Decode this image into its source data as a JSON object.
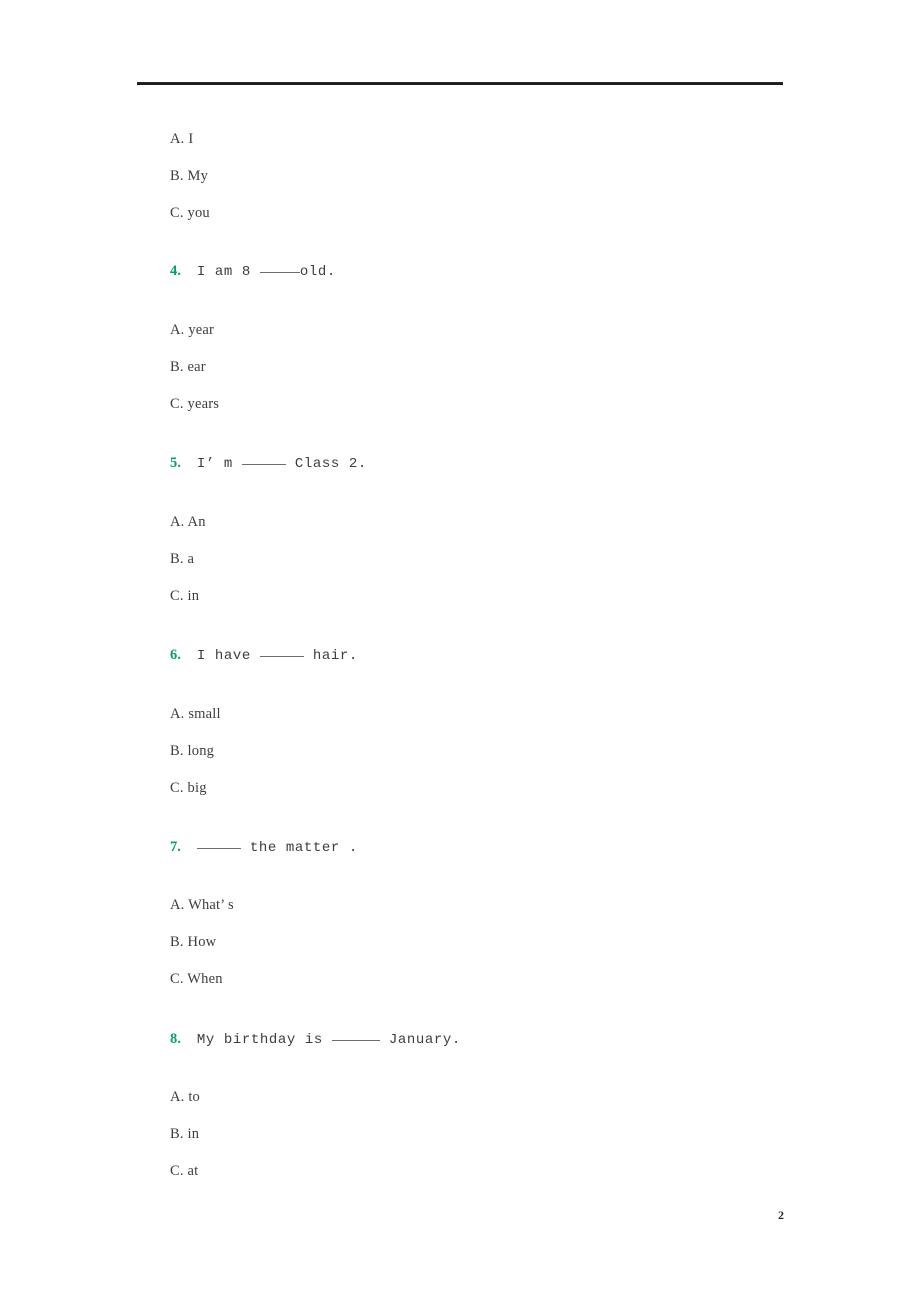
{
  "document": {
    "page_number": "2",
    "accent_color": "#00a070",
    "text_color": "#3d3d3d"
  },
  "orphan_options": [
    {
      "letter": "A.",
      "text": "I"
    },
    {
      "letter": "B.",
      "text": "My"
    },
    {
      "letter": "C.",
      "text": "you"
    }
  ],
  "questions": [
    {
      "number": "4.",
      "stem_before": "I am 8 ",
      "stem_after": "old.",
      "options": [
        {
          "letter": "A.",
          "text": "year"
        },
        {
          "letter": "B.",
          "text": "ear"
        },
        {
          "letter": "C.",
          "text": "years"
        }
      ]
    },
    {
      "number": "5.",
      "stem_before": "I’ m ",
      "stem_after": " Class 2.",
      "options": [
        {
          "letter": "A.",
          "text": "An"
        },
        {
          "letter": "B.",
          "text": "a"
        },
        {
          "letter": "C.",
          "text": "in"
        }
      ]
    },
    {
      "number": "6.",
      "stem_before": "I have ",
      "stem_after": " hair.",
      "options": [
        {
          "letter": "A.",
          "text": "small"
        },
        {
          "letter": "B.",
          "text": "long"
        },
        {
          "letter": "C.",
          "text": "big"
        }
      ]
    },
    {
      "number": "7.",
      "stem_before": "",
      "stem_after": " the matter .",
      "options": [
        {
          "letter": "A.",
          "text": "What’ s"
        },
        {
          "letter": "B.",
          "text": "How"
        },
        {
          "letter": "C.",
          "text": "When"
        }
      ]
    },
    {
      "number": "8.",
      "stem_before": "My birthday is ",
      "stem_after": " January.",
      "options": [
        {
          "letter": "A.",
          "text": "to"
        },
        {
          "letter": "B.",
          "text": "in"
        },
        {
          "letter": "C.",
          "text": "at"
        }
      ]
    }
  ]
}
